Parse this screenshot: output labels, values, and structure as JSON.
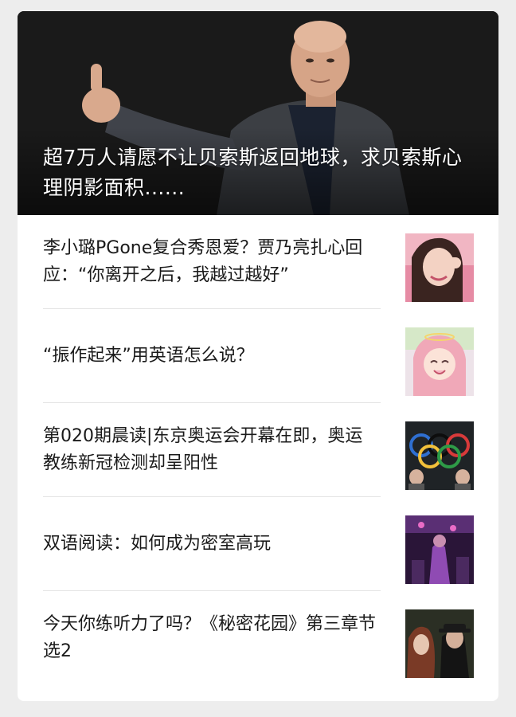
{
  "hero": {
    "title": "超7万人请愿不让贝索斯返回地球，求贝索斯心理阴影面积......",
    "image": "man-thumbs-up-photo"
  },
  "articles": [
    {
      "title": "李小璐PGone复合秀恩爱？贾乃亮扎心回应：“你离开之后，我越过越好”",
      "thumbnail": "woman-smiling-photo"
    },
    {
      "title": "“振作起来”用英语怎么说？",
      "thumbnail": "anime-girl-illustration"
    },
    {
      "title": "第020期晨读|东京奥运会开幕在即，奥运教练新冠检测却呈阳性",
      "thumbnail": "olympic-rings-photo"
    },
    {
      "title": "双语阅读：如何成为密室高玩",
      "thumbnail": "escape-room-photo"
    },
    {
      "title": "今天你练听力了吗？《秘密花园》第三章节选2",
      "thumbnail": "two-people-photo"
    }
  ],
  "colors": {
    "background": "#ededed",
    "card": "#ffffff",
    "text": "#1a1a1a",
    "divider": "#e3e3e3"
  }
}
